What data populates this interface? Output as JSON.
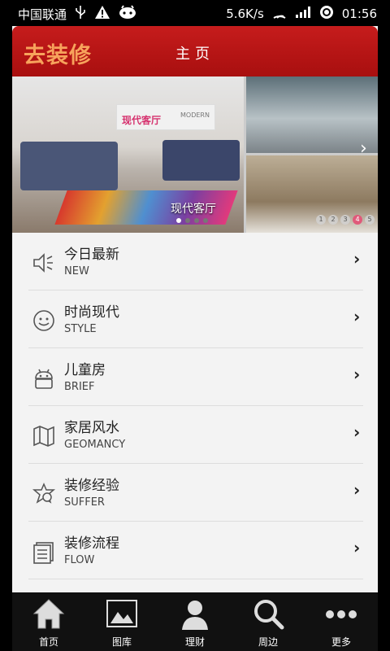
{
  "status_bar": {
    "carrier": "中国联通",
    "speed": "5.6K/s",
    "time": "01:56"
  },
  "header": {
    "logo_text": "去装修",
    "title": "主页"
  },
  "banner": {
    "caption": "现代客厅",
    "sign_text": "现代客厅",
    "sign_en": "MODERN",
    "pager_labels": [
      "1",
      "2",
      "3",
      "4",
      "5"
    ]
  },
  "menu": [
    {
      "cn": "今日最新",
      "en": "NEW",
      "icon": "speaker-icon"
    },
    {
      "cn": "时尚现代",
      "en": "STYLE",
      "icon": "smiley-icon"
    },
    {
      "cn": "儿童房",
      "en": "BRIEF",
      "icon": "robot-icon"
    },
    {
      "cn": "家居风水",
      "en": "GEOMANCY",
      "icon": "map-icon"
    },
    {
      "cn": "装修经验",
      "en": "SUFFER",
      "icon": "experience-icon"
    },
    {
      "cn": "装修流程",
      "en": "FLOW",
      "icon": "document-list-icon"
    }
  ],
  "tabs": [
    {
      "label": "首页",
      "icon": "home-icon"
    },
    {
      "label": "图库",
      "icon": "gallery-icon"
    },
    {
      "label": "理财",
      "icon": "user-icon"
    },
    {
      "label": "周边",
      "icon": "search-icon"
    },
    {
      "label": "更多",
      "icon": "more-icon"
    }
  ],
  "colors": {
    "header_red": "#b81515",
    "logo_orange": "#f7a35c",
    "tabbar_bg": "#111111"
  }
}
